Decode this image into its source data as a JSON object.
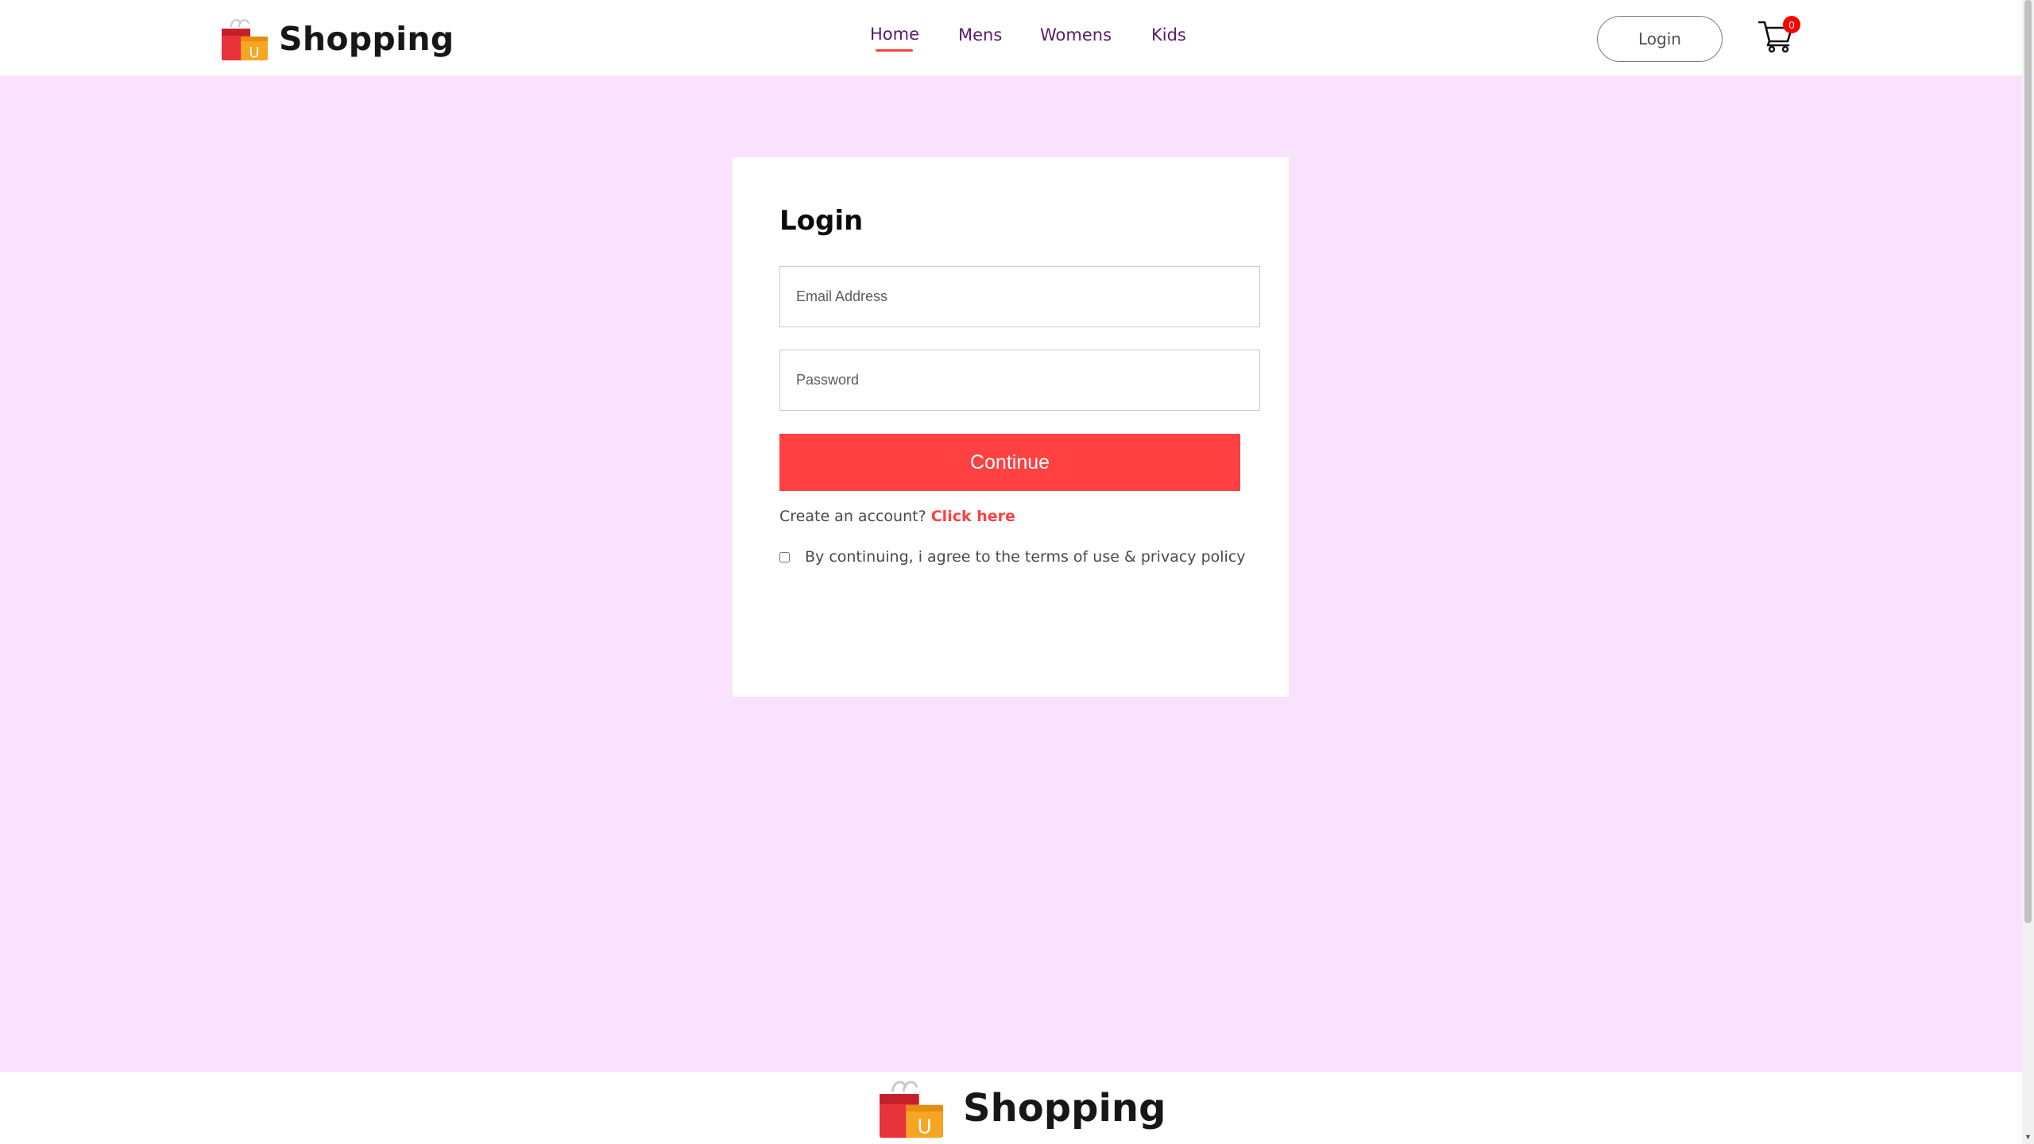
{
  "brand": {
    "name": "Shopping",
    "logo_icon": "shopping-bag-icon",
    "logo_letter": "U"
  },
  "nav": {
    "items": [
      {
        "label": "Home",
        "active": true
      },
      {
        "label": "Mens",
        "active": false
      },
      {
        "label": "Womens",
        "active": false
      },
      {
        "label": "Kids",
        "active": false
      }
    ],
    "login_label": "Login",
    "cart_icon": "cart-icon",
    "cart_count": "0"
  },
  "login": {
    "title": "Login",
    "email_placeholder": "Email Address",
    "email_value": "",
    "password_placeholder": "Password",
    "password_value": "",
    "continue_label": "Continue",
    "signup_prompt": "Create an account?",
    "signup_link": "Click here",
    "agree_text": "By continuing, i agree to the terms of use & privacy policy",
    "agree_checked": false
  },
  "footer": {
    "brand_name": "Shopping"
  },
  "colors": {
    "page_background": "#fae1fd",
    "accent": "#ff4141",
    "nav_text": "#5a1a6b",
    "badge": "#ff0000"
  }
}
